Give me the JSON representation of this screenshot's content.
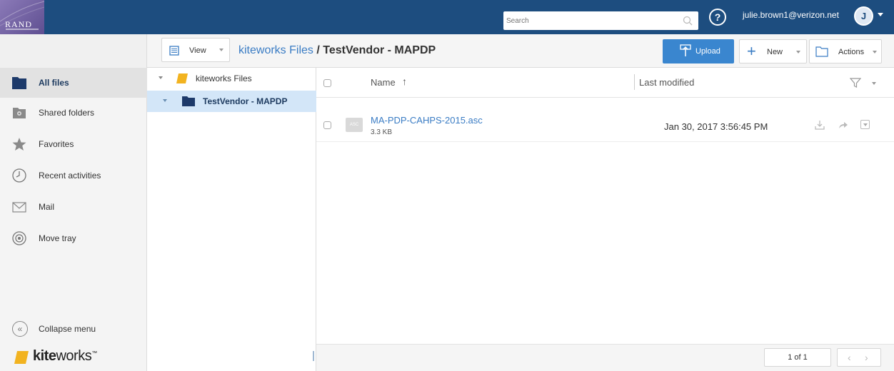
{
  "header": {
    "logo_text": "RAND",
    "search_placeholder": "Search",
    "help_label": "?",
    "user_email": "julie.brown1@verizon.net",
    "avatar_initial": "J",
    "brand_color": "#1d4d7f"
  },
  "toolbar": {
    "view_label": "View",
    "breadcrumb_root": "kiteworks Files",
    "breadcrumb_separator": " / ",
    "breadcrumb_current": "TestVendor - MAPDP",
    "upload_label": "Upload",
    "new_label": "New",
    "actions_label": "Actions",
    "upload_color": "#3a86cf"
  },
  "sidebar": {
    "items": [
      {
        "label": "All files",
        "icon": "folder-icon",
        "active": true
      },
      {
        "label": "Shared folders",
        "icon": "shared-folder-icon",
        "active": false
      },
      {
        "label": "Favorites",
        "icon": "star-icon",
        "active": false
      },
      {
        "label": "Recent activities",
        "icon": "clock-icon",
        "active": false
      },
      {
        "label": "Mail",
        "icon": "mail-icon",
        "active": false
      },
      {
        "label": "Move tray",
        "icon": "target-icon",
        "active": false
      }
    ],
    "collapse_label": "Collapse menu",
    "brand_bold": "kite",
    "brand_rest": "works",
    "brand_tm": "™"
  },
  "tree": {
    "items": [
      {
        "label": "kiteworks Files",
        "selected": false
      },
      {
        "label": "TestVendor - MAPDP",
        "selected": true
      }
    ]
  },
  "list": {
    "col_name": "Name",
    "sort_arrow": "↑",
    "col_modified": "Last modified",
    "files": [
      {
        "name": "MA-PDP-CAHPS-2015.asc",
        "size": "3.3 KB",
        "modified": "Jan 30, 2017 3:56:45 PM",
        "thumb": "ASC"
      }
    ],
    "pager": "1 of 1"
  }
}
